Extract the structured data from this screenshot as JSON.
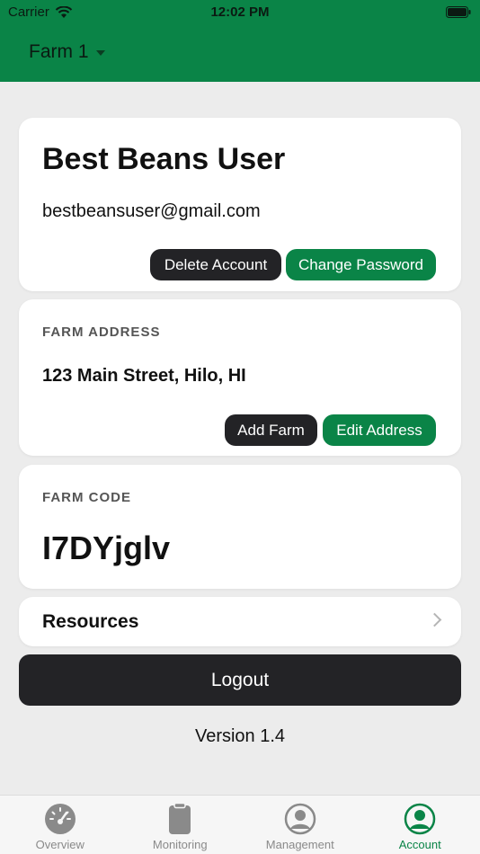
{
  "status": {
    "carrier": "Carrier",
    "time": "12:02 PM"
  },
  "header": {
    "farm_name": "Farm 1"
  },
  "user": {
    "name": "Best Beans User",
    "email": "bestbeansuser@gmail.com",
    "delete_label": "Delete Account",
    "change_password_label": "Change Password"
  },
  "address": {
    "section_label": "FARM ADDRESS",
    "value": "123 Main Street, Hilo, HI",
    "add_farm_label": "Add Farm",
    "edit_address_label": "Edit Address"
  },
  "code": {
    "section_label": "FARM CODE",
    "value": "I7DYjglv"
  },
  "resources": {
    "label": "Resources"
  },
  "logout": {
    "label": "Logout"
  },
  "version": {
    "label": "Version 1.4"
  },
  "tabs": [
    {
      "label": "Overview",
      "icon": "gauge-icon"
    },
    {
      "label": "Monitoring",
      "icon": "clipboard-icon"
    },
    {
      "label": "Management",
      "icon": "person-circle-icon"
    },
    {
      "label": "Account",
      "icon": "account-circle-icon",
      "active": true
    }
  ],
  "colors": {
    "brand_green": "#0a8447",
    "dark_button": "#232326",
    "background": "#ececec"
  }
}
